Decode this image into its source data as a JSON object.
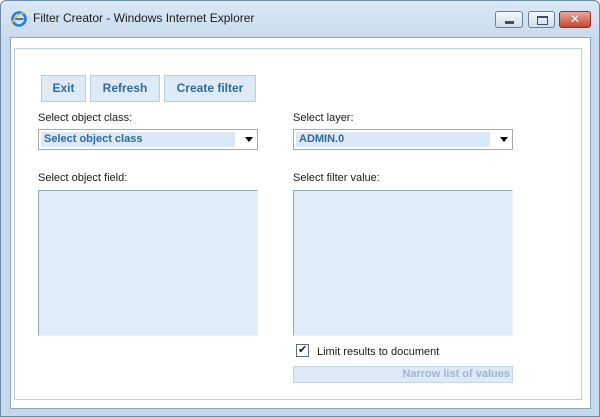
{
  "window": {
    "title": "Filter Creator - Windows Internet Explorer",
    "app_icon": "ie-logo-icon",
    "controls": {
      "minimize": "minimize-icon",
      "maximize": "maximize-icon",
      "close": "close-icon",
      "close_glyph": "✕"
    }
  },
  "toolbar": {
    "exit_label": "Exit",
    "refresh_label": "Refresh",
    "create_filter_label": "Create filter"
  },
  "form": {
    "object_class_label": "Select object class:",
    "object_class_value": "Select object class",
    "layer_label": "Select layer:",
    "layer_value": "ADMIN.0",
    "object_field_label": "Select object field:",
    "filter_value_label": "Select filter value:",
    "object_field_items": [],
    "filter_value_items": [],
    "limit_checkbox": {
      "label": "Limit results to document",
      "checked": true,
      "glyph": "✔"
    },
    "narrow_button_label": "Narrow list of values"
  },
  "colors": {
    "accent": "#2f6b9a",
    "button_bg": "#deebf7",
    "list_bg": "#deebf8",
    "title_bar": "#c9dbee",
    "close_button": "#c9452f"
  }
}
